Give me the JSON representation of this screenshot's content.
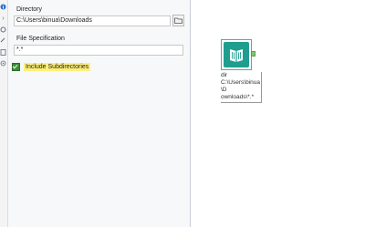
{
  "config": {
    "directory_label": "Directory",
    "directory_value": "C:\\Users\\binua\\Downloads",
    "filespec_label": "File Specification",
    "filespec_value": "*.*",
    "include_subdirs_label": "Include Subdirectories",
    "include_subdirs_checked": true
  },
  "canvas": {
    "tool_name": "Directory",
    "tool_annotation_line1": "dir",
    "tool_annotation_line2": "C:\\Users\\binua\\D",
    "tool_annotation_line3": "ownloads\\*.*"
  },
  "icons": [
    "info-icon",
    "arrow-icon",
    "settings-icon",
    "link-icon",
    "document-icon",
    "gear-icon",
    "folder-icon",
    "book-icon",
    "output-anchor-icon"
  ]
}
